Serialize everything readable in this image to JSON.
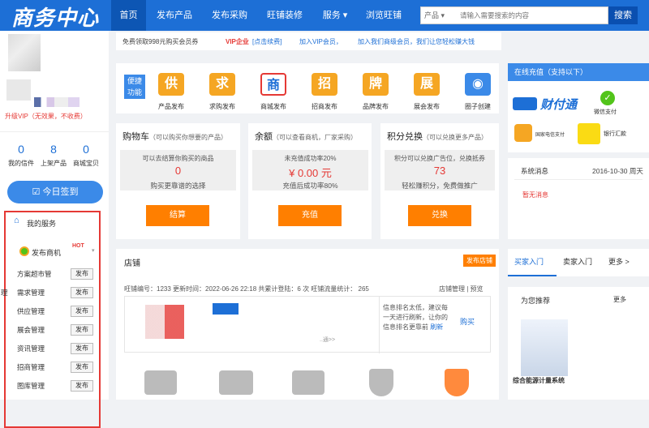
{
  "logo": "商务中心",
  "nav": [
    "首页",
    "发布产品",
    "发布采购",
    "旺铺装修",
    "服务 ▾",
    "浏览旺铺"
  ],
  "search": {
    "category": "产品 ▾",
    "placeholder": "请输入需要搜索的内容",
    "button": "搜索"
  },
  "profile": {
    "upgrade": "升级VIP（无效果，不收费）"
  },
  "stats": [
    {
      "num": "0",
      "label": "我的信件"
    },
    {
      "num": "8",
      "label": "上架产品"
    },
    {
      "num": "0",
      "label": "商城宝贝"
    }
  ],
  "checkin": "☑ 今日签到",
  "services": {
    "title": "我的服务",
    "publish": "发布商机",
    "hot": "HOT",
    "btn": "发布",
    "items": [
      "方案超市管",
      "需求管理",
      "供应管理",
      "展会管理",
      "资讯管理",
      "招商管理",
      "图库管理"
    ],
    "cut": "理"
  },
  "banner": {
    "free": "免费领取998元购买会员券",
    "vip": "VIP企业",
    "vip_link": "[点击续费]",
    "join": "加入VIP会员，",
    "join2": "加入我们商级会员，我们让您轻松赚大钱"
  },
  "quick": {
    "label": "便捷功能",
    "items": [
      {
        "char": "供",
        "label": "产品发布",
        "color": "#f5a623"
      },
      {
        "char": "求",
        "label": "求购发布",
        "color": "#f5a623"
      },
      {
        "char": "商",
        "label": "商城发布",
        "color": "#1d6fd6"
      },
      {
        "char": "招",
        "label": "招商发布",
        "color": "#f5a623"
      },
      {
        "char": "牌",
        "label": "品牌发布",
        "color": "#f5a623"
      },
      {
        "char": "展",
        "label": "展会发布",
        "color": "#f5a623"
      },
      {
        "char": "◉",
        "label": "圈子创建",
        "color": "#3b8ae8"
      }
    ]
  },
  "cards": [
    {
      "title": "购物车",
      "sub": "（可以购买你想要的产品）",
      "desc1": "可以去结算你购买的商品",
      "val": "0",
      "desc2": "购买更靠谱的选择",
      "btn": "结算"
    },
    {
      "title": "余额",
      "sub": "（可以查看商机，厂家采购）",
      "desc1": "未充值成功率20%",
      "val": "¥ 0.00 元",
      "desc2": "充值后成功率80%",
      "btn": "充值"
    },
    {
      "title": "积分兑换",
      "sub": "（可以兑换更多产品）",
      "desc1": "积分可以兑换广告位，兑换抵券",
      "val": "73",
      "desc2": "轻松赚积分，免费做推广",
      "btn": "兑换"
    }
  ],
  "shop": {
    "title": "店铺",
    "btn": "发布店铺",
    "meta": "旺铺编号：1233 更新时间：2022-06-26 22:18 共累计登陆：6 次 旺铺流量统计： 265",
    "manage": "店铺管理 | 预览",
    "rank": "信息排名太低，建议每一天进行刷新，让你的信息排名更靠前",
    "refresh": "刷新",
    "buy": "购买",
    "more": "..通>>"
  },
  "right": {
    "recharge": "在线充值（支持以下）",
    "brand": "财付通",
    "wx": "微信支付",
    "bank": "银行汇款",
    "cmcc": "国家电信支付",
    "msg": "系统消息",
    "date": "2016-10-30 周天",
    "nomsg": "暂无消息",
    "tabs": [
      "买家入门",
      "卖家入门",
      "更多 >"
    ],
    "recommend": "为您推荐",
    "more": "更多",
    "product": "综合能源计量系统"
  }
}
